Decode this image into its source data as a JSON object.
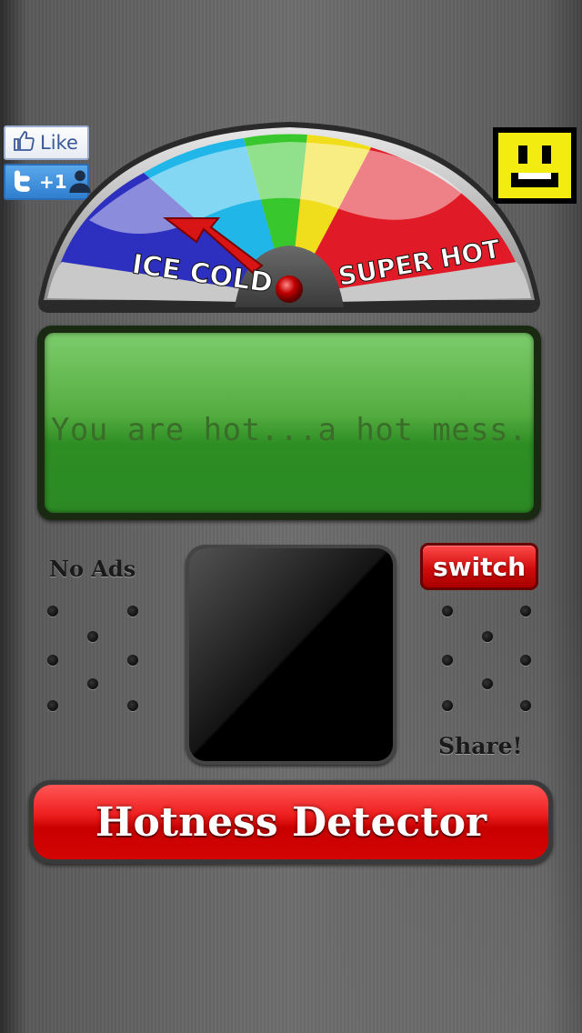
{
  "social": {
    "like_label": "Like",
    "plus_label": "+1"
  },
  "gauge": {
    "left_label": "ICE COLD",
    "right_label": "SUPER HOT",
    "needle_position": "pointing toward ice cold"
  },
  "display": {
    "message": "You are hot...a hot mess."
  },
  "controls": {
    "no_ads_label": "No Ads",
    "switch_label": "switch",
    "share_label": "Share!",
    "main_button_label": "Hotness Detector"
  },
  "colors": {
    "accent_red": "#e00f0f",
    "display_green": "#3f9a31",
    "smiley_yellow": "#f2ec10"
  }
}
